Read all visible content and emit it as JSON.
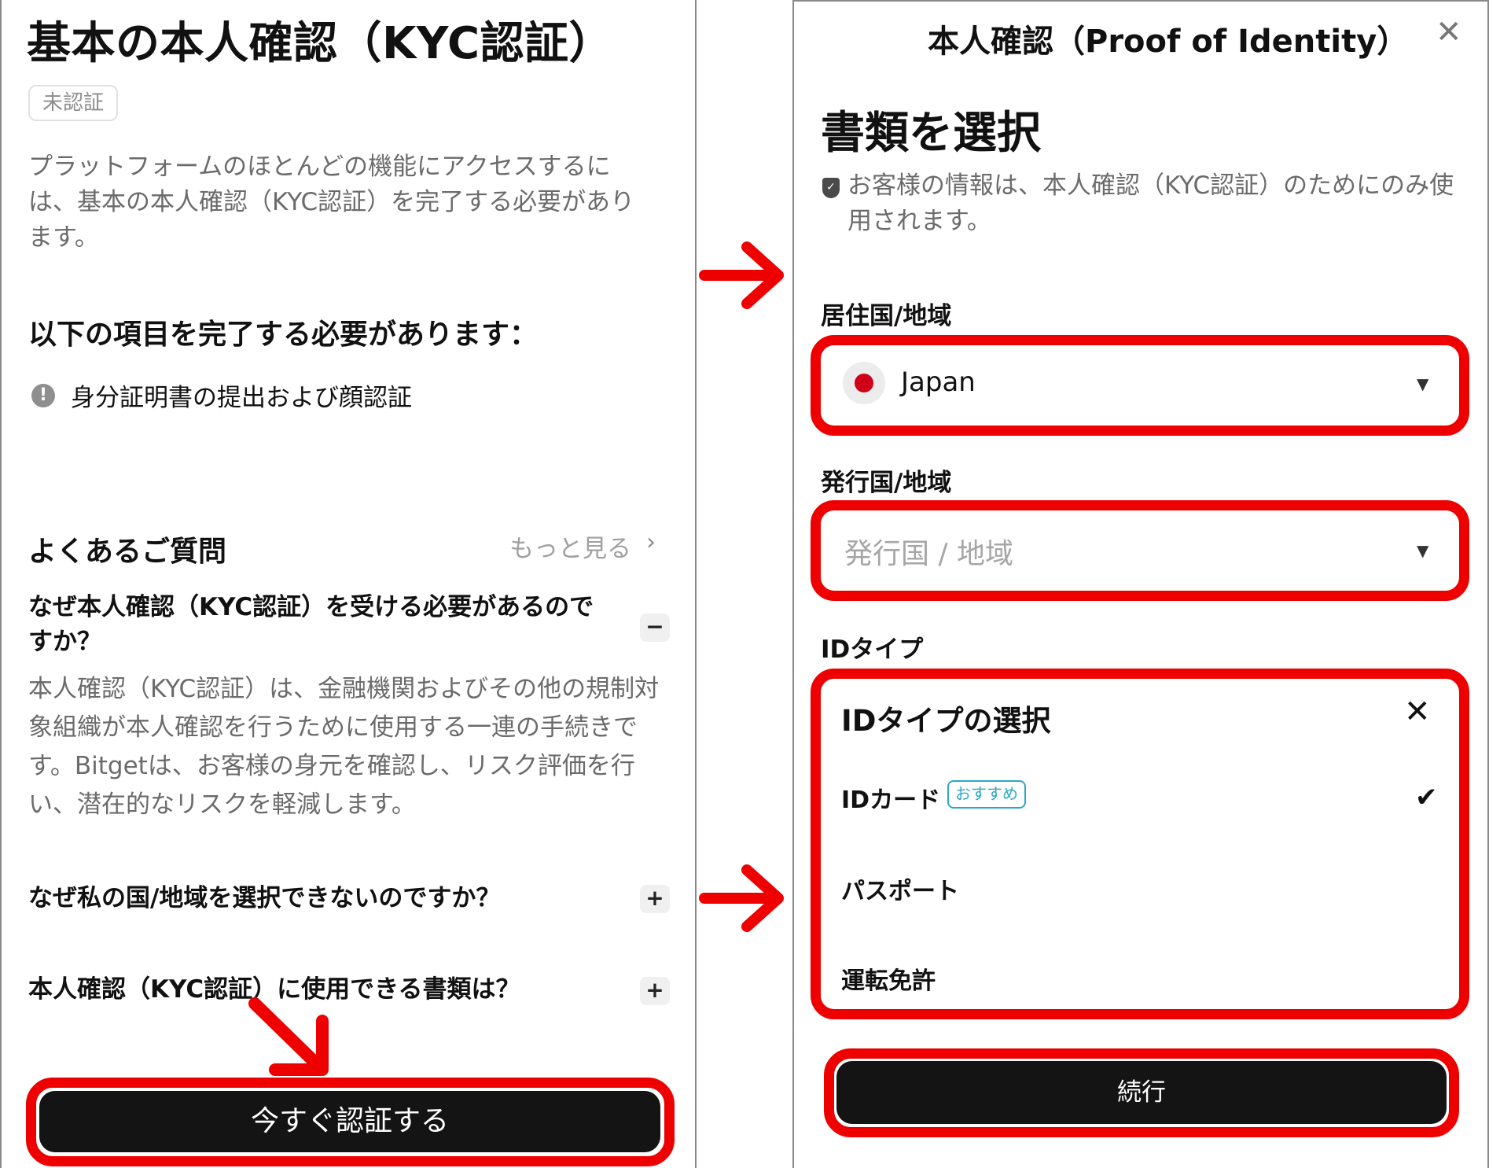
{
  "left": {
    "title": "基本の本人確認（KYC認証）",
    "status_badge": "未認証",
    "description": "プラットフォームのほとんどの機能にアクセスするには、基本の本人確認（KYC認証）を完了する必要があります。",
    "requirements_heading": "以下の項目を完了する必要があります：",
    "requirement_item": "身分証明書の提出および顔認証",
    "faq_heading": "よくあるご質問",
    "faq_more": "もっと見る",
    "faq": [
      {
        "question": "なぜ本人確認（KYC認証）を受ける必要があるのですか？",
        "answer": "本人確認（KYC認証）は、金融機関およびその他の規制対象組織が本人確認を行うために使用する一連の手続きです。Bitgetは、お客様の身元を確認し、リスク評価を行い、潜在的なリスクを軽減します。",
        "toggle": "−"
      },
      {
        "question": "なぜ私の国/地域を選択できないのですか？",
        "toggle": "+"
      },
      {
        "question": "本人確認（KYC認証）に使用できる書類は？",
        "toggle": "+"
      }
    ],
    "cta_label": "今すぐ認証する"
  },
  "right": {
    "title": "本人確認（Proof of Identity）",
    "close_glyph": "✕",
    "heading": "書類を選択",
    "privacy_note": "お客様の情報は、本人確認（KYC認証）のためにのみ使用されます。",
    "residence_label": "居住国/地域",
    "residence_value": "Japan",
    "issuing_label": "発行国/地域",
    "issuing_placeholder": "発行国 / 地域",
    "id_type_label": "IDタイプ",
    "id_type_panel_title": "IDタイプの選択",
    "id_options": [
      {
        "label": "IDカード",
        "badge": "おすすめ",
        "selected": true
      },
      {
        "label": "パスポート"
      },
      {
        "label": "運転免許"
      }
    ],
    "submit_label": "続行"
  },
  "colors": {
    "highlight": "#ee0000",
    "button": "#141414",
    "badge_accent": "#2aa8c8",
    "flag_red": "#d00018"
  }
}
